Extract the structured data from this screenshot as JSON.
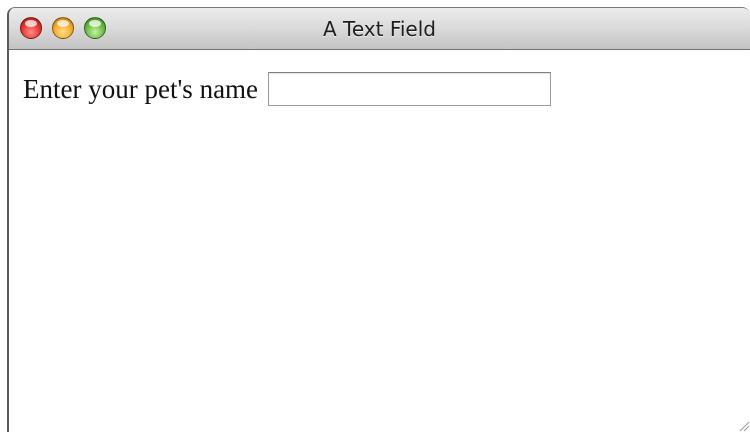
{
  "window": {
    "title": "A Text Field",
    "controls": {
      "close": {
        "icon": "close-traffic-light-icon",
        "color": "#e5312a"
      },
      "minimize": {
        "icon": "minimize-traffic-light-icon",
        "color": "#f5a623"
      },
      "zoom": {
        "icon": "zoom-traffic-light-icon",
        "color": "#63b83b"
      }
    }
  },
  "form": {
    "pet_name_label": "Enter your pet's name",
    "pet_name_value": "",
    "pet_name_placeholder": ""
  },
  "icons": {
    "resize": "resize-grip-icon"
  }
}
